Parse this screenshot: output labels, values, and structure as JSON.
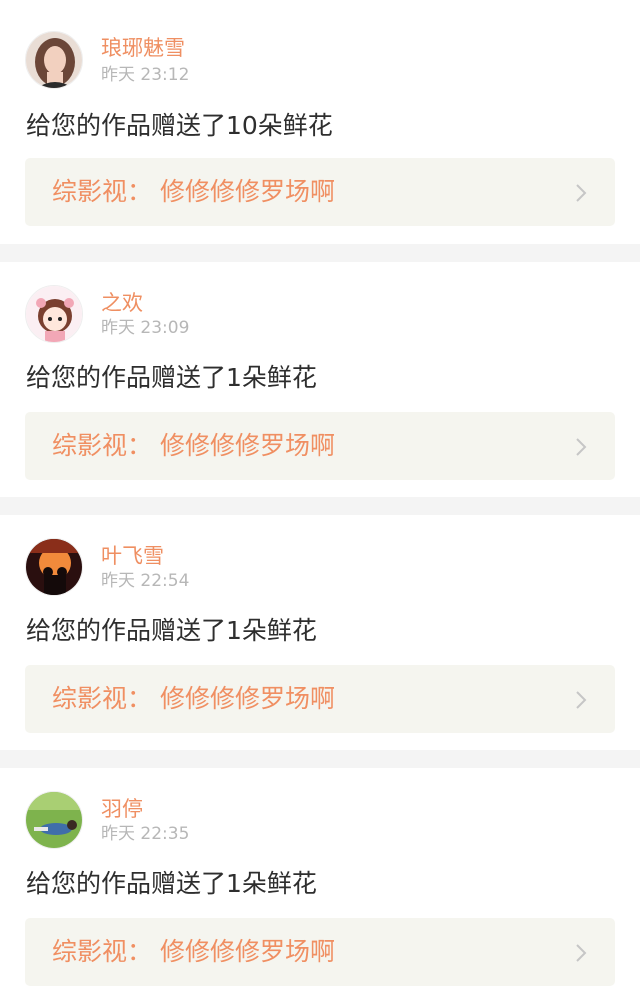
{
  "header": {
    "active_tab_indicator_color": "#e97a9c"
  },
  "notifications": [
    {
      "avatar_icon": "avatar-portrait-girl-icon",
      "username": "琅琊魅雪",
      "timestamp": "昨天 23:12",
      "message": "给您的作品赠送了10朵鲜花",
      "work_label": "综影视：  修修修修罗场啊"
    },
    {
      "avatar_icon": "avatar-cartoon-girl-icon",
      "username": "之欢",
      "timestamp": "昨天 23:09",
      "message": "给您的作品赠送了1朵鲜花",
      "work_label": "综影视：  修修修修罗场啊"
    },
    {
      "avatar_icon": "avatar-sunset-couple-icon",
      "username": "叶飞雪",
      "timestamp": "昨天 22:54",
      "message": "给您的作品赠送了1朵鲜花",
      "work_label": "综影视：  修修修修罗场啊"
    },
    {
      "avatar_icon": "avatar-person-on-grass-icon",
      "username": "羽停",
      "timestamp": "昨天 22:35",
      "message": "给您的作品赠送了1朵鲜花",
      "work_label": "综影视：  修修修修罗场啊"
    }
  ],
  "colors": {
    "username": "#ef8f62",
    "timestamp": "#b7b7b7",
    "message": "#2e2e2e",
    "work_card_bg": "#f5f5ef",
    "divider": "#f4f4f4"
  }
}
